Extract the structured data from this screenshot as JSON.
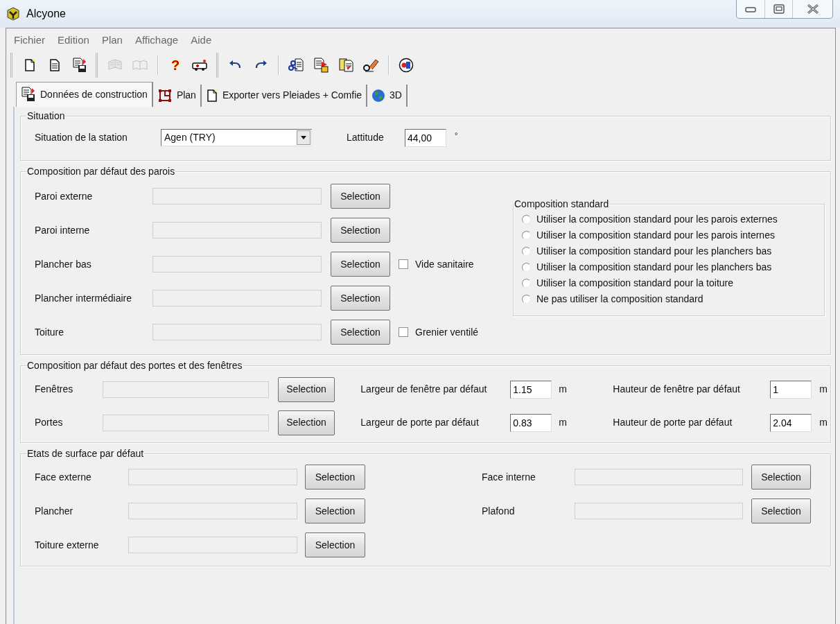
{
  "window": {
    "title": "Alcyone"
  },
  "menu": [
    {
      "label": "Fichier"
    },
    {
      "label": "Edition"
    },
    {
      "label": "Plan"
    },
    {
      "label": "Affichage"
    },
    {
      "label": "Aide"
    }
  ],
  "toolbar": [
    {
      "items": [
        {
          "kind": "icon",
          "disabled": false
        },
        {
          "kind": "icon",
          "disabled": false
        },
        {
          "kind": "icon",
          "disabled": false
        }
      ]
    },
    {
      "items": [
        {
          "kind": "icon",
          "disabled": true
        },
        {
          "kind": "icon",
          "disabled": true
        },
        {
          "kind": "separator"
        },
        {
          "kind": "glyph",
          "text": "?",
          "disabled": false
        },
        {
          "kind": "icon",
          "disabled": false
        }
      ]
    },
    {
      "items": [
        {
          "kind": "icon",
          "disabled": false
        },
        {
          "kind": "icon",
          "disabled": false
        },
        {
          "kind": "separator"
        },
        {
          "kind": "icon",
          "disabled": false
        },
        {
          "kind": "icon",
          "disabled": false
        },
        {
          "kind": "icon",
          "disabled": false
        },
        {
          "kind": "icon",
          "disabled": false
        },
        {
          "kind": "separator"
        },
        {
          "kind": "icon",
          "disabled": false
        }
      ]
    }
  ],
  "tabs": [
    {
      "label": "Données de construction",
      "selected": true
    },
    {
      "label": "Plan",
      "selected": false
    },
    {
      "label": "Exporter vers Pleiades + Comfie",
      "selected": false
    },
    {
      "label": "3D",
      "selected": false
    }
  ],
  "situation": {
    "title": "Situation",
    "station_label": "Situation de la station",
    "station_value": "Agen (TRY)",
    "latitude_label": "Lattitude",
    "latitude_value": "44,00",
    "latitude_unit": "°"
  },
  "parois": {
    "title": "Composition par défaut des parois",
    "rows": [
      {
        "label": "Paroi externe",
        "button": "Selection"
      },
      {
        "label": "Paroi interne",
        "button": "Selection"
      },
      {
        "label": "Plancher bas",
        "button": "Selection",
        "checkbox": {
          "label": "Vide sanitaire",
          "checked": false
        }
      },
      {
        "label": "Plancher intermédiaire",
        "button": "Selection"
      },
      {
        "label": "Toiture",
        "button": "Selection",
        "checkbox": {
          "label": "Grenier ventilé",
          "checked": false
        }
      }
    ],
    "standard": {
      "title": "Composition standard",
      "options": [
        {
          "label": "Utiliser la composition standard pour les parois externes",
          "selected": false
        },
        {
          "label": "Utiliser la composition standard pour les parois internes",
          "selected": false
        },
        {
          "label": "Utiliser la composition standard pour les planchers bas",
          "selected": false
        },
        {
          "label": "Utiliser la composition standard pour les planchers bas",
          "selected": false
        },
        {
          "label": "Utiliser la composition standard pour la toiture",
          "selected": false
        },
        {
          "label": "Ne pas utiliser la composition standard",
          "selected": false
        }
      ]
    }
  },
  "ouvertures": {
    "title": "Composition par défaut des portes et des fenêtres",
    "rows": [
      {
        "label": "Fenêtres",
        "button": "Selection",
        "width_label": "Largeur de fenêtre par défaut",
        "width_value": "1.15",
        "width_unit": "m",
        "height_label": "Hauteur de fenêtre par défaut",
        "height_value": "1",
        "height_unit": "m"
      },
      {
        "label": "Portes",
        "button": "Selection",
        "width_label": "Largeur de porte par défaut",
        "width_value": "0.83",
        "width_unit": "m",
        "height_label": "Hauteur de porte par défaut",
        "height_value": "2.04",
        "height_unit": "m"
      }
    ]
  },
  "surfaces": {
    "title": "Etats de surface par défaut",
    "left": [
      {
        "label": "Face externe",
        "button": "Selection"
      },
      {
        "label": "Plancher",
        "button": "Selection"
      },
      {
        "label": "Toiture externe",
        "button": "Selection"
      }
    ],
    "right": [
      {
        "label": "Face interne",
        "button": "Selection"
      },
      {
        "label": "Plafond",
        "button": "Selection"
      }
    ]
  }
}
